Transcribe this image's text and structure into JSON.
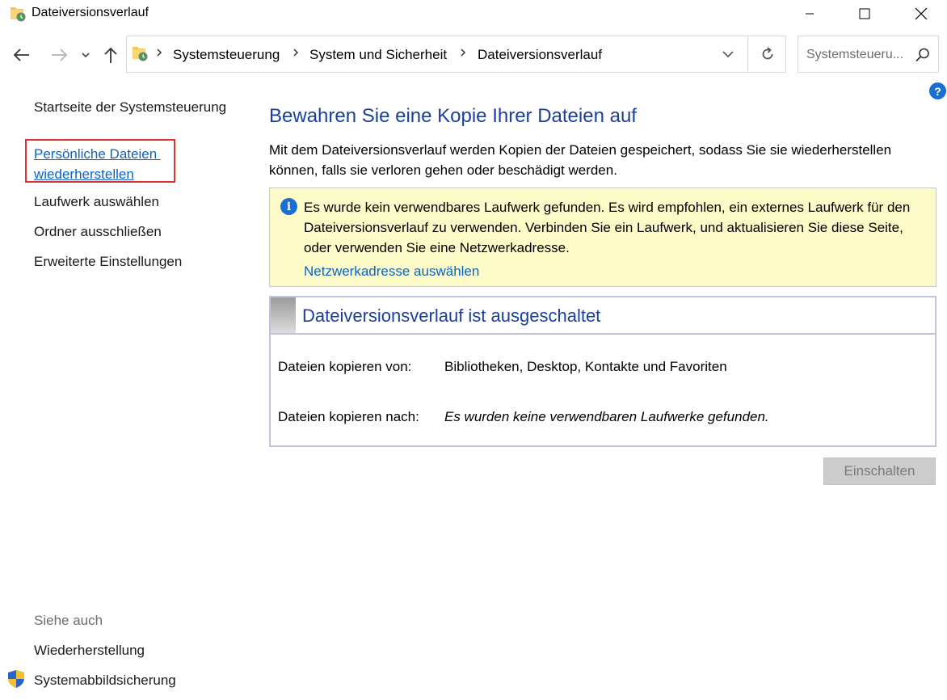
{
  "window": {
    "title": "Dateiversionsverlauf",
    "controls": [
      "minimize",
      "maximize",
      "close"
    ]
  },
  "navigation": {
    "back_icon": "arrow-left-icon",
    "forward_icon": "arrow-right-icon",
    "recent_icon": "chevron-down-icon",
    "up_icon": "arrow-up-icon",
    "breadcrumbs": [
      "Systemsteuerung",
      "System und Sicherheit",
      "Dateiversionsverlauf"
    ],
    "refresh_icon": "refresh-icon"
  },
  "search": {
    "placeholder": "Systemsteueru..."
  },
  "help_label": "?",
  "sidebar": {
    "home": "Startseite der Systemsteuerung",
    "restore_line1": "Persönliche Dateien ",
    "restore_line2": "wiederherstellen",
    "drive": "Laufwerk auswählen",
    "exclude": "Ordner ausschließen",
    "advanced": "Erweiterte Einstellungen",
    "see_also": "Siehe auch",
    "recovery": "Wiederherstellung",
    "system_image": "Systemabbildsicherung"
  },
  "main": {
    "heading": "Bewahren Sie eine Kopie Ihrer Dateien auf",
    "description": "Mit dem Dateiversionsverlauf werden Kopien der Dateien gespeichert, sodass Sie sie wiederherstellen können, falls sie verloren gehen oder beschädigt werden.",
    "info": {
      "icon_label": "i",
      "text": "Es wurde kein verwendbares Laufwerk gefunden. Es wird empfohlen, ein externes Laufwerk für den Dateiversionsverlauf zu verwenden. Verbinden Sie ein Laufwerk, und aktualisieren Sie diese Seite, oder verwenden Sie eine Netzwerkadresse.",
      "link": "Netzwerkadresse auswählen"
    },
    "status": {
      "title": "Dateiversionsverlauf ist ausgeschaltet",
      "copy_from_label": "Dateien kopieren von:",
      "copy_from_value": "Bibliotheken, Desktop, Kontakte und Favoriten",
      "copy_to_label": "Dateien kopieren nach:",
      "copy_to_value": "Es wurden keine verwendbaren Laufwerke gefunden."
    },
    "enable_button": "Einschalten"
  },
  "colors": {
    "heading_blue": "#1a3f9e",
    "link_blue": "#0b63c4",
    "info_background": "#fdfbc8",
    "highlight_red": "#e03232"
  }
}
